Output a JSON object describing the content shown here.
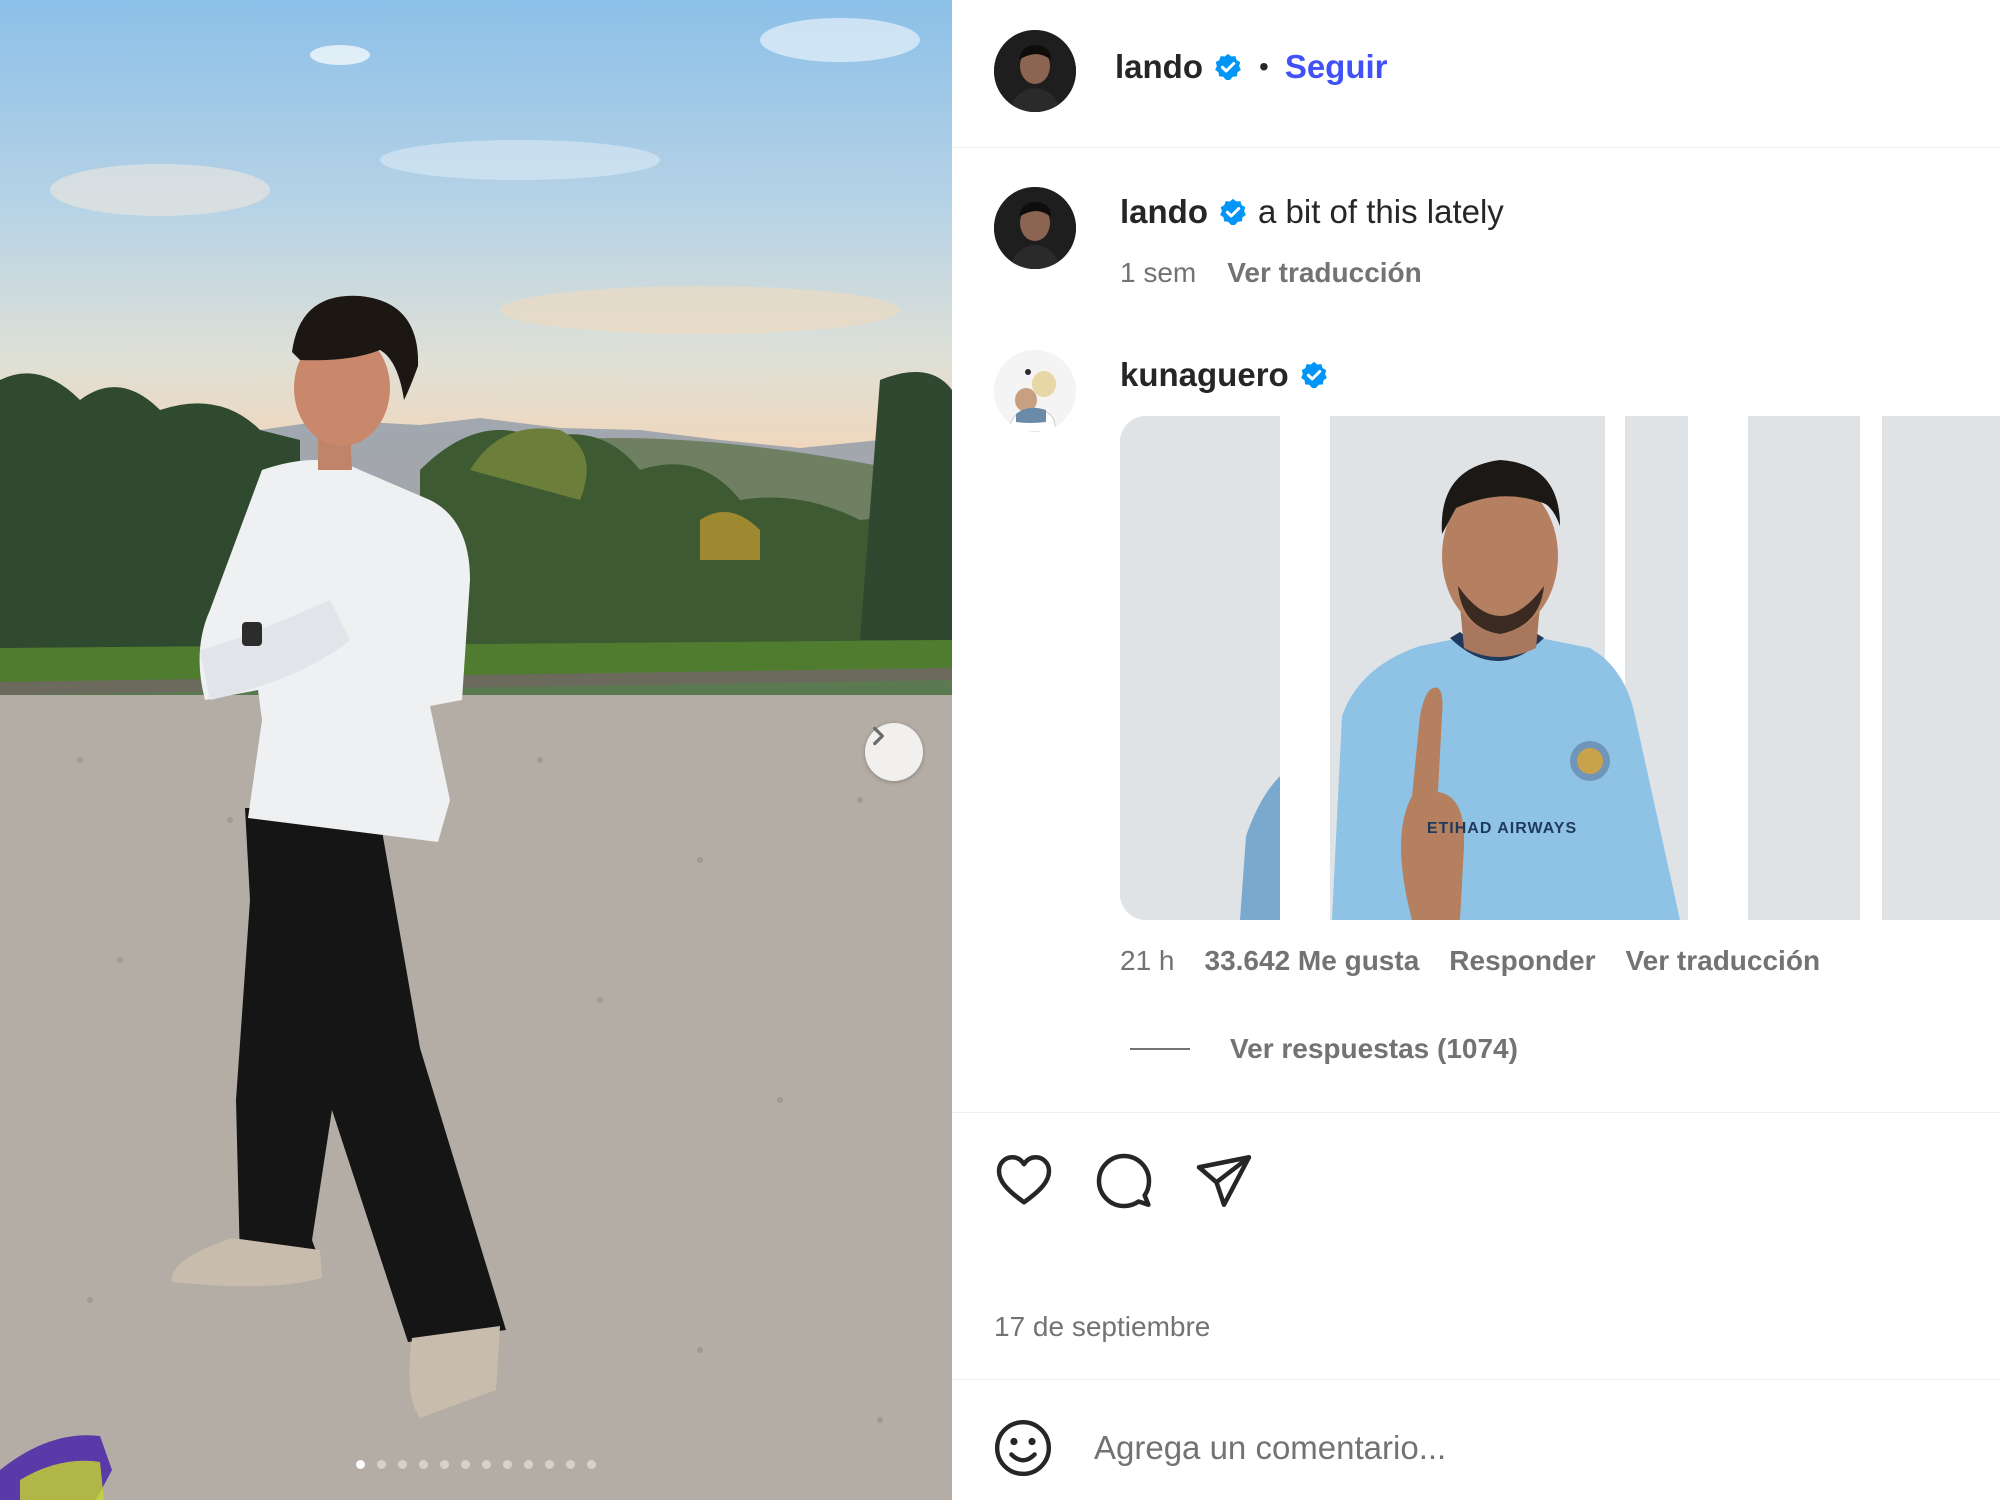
{
  "post": {
    "author": "lando",
    "follow_label": "Seguir",
    "separator": "•",
    "carousel": {
      "slide_count": 12,
      "active_index": 0
    }
  },
  "caption": {
    "author": "lando",
    "text": "a bit of this lately",
    "time": "1 sem",
    "translate_label": "Ver traducción"
  },
  "comment": {
    "author": "kunaguero",
    "gif_jersey_text": "ETIHAD AIRWAYS",
    "time": "21 h",
    "likes": "33.642 Me gusta",
    "reply_label": "Responder",
    "translate_label": "Ver traducción",
    "view_replies": "Ver respuestas (1074)"
  },
  "footer": {
    "date": "17 de septiembre",
    "comment_placeholder": "Agrega un comentario..."
  },
  "colors": {
    "accent_link": "#4150f7",
    "verified_badge": "#0095f6",
    "muted_text": "#737373",
    "primary_text": "#262626"
  },
  "icons": [
    "verified-badge-icon",
    "chevron-right-icon",
    "heart-icon",
    "comment-icon",
    "share-icon",
    "emoji-icon"
  ]
}
